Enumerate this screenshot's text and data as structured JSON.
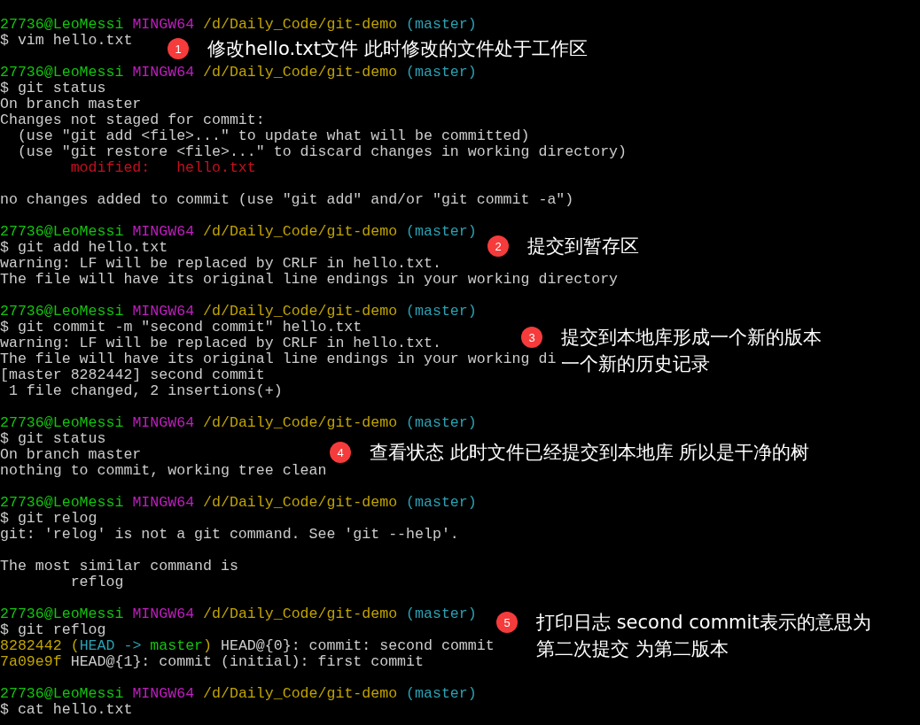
{
  "terminal_blocks": [
    {
      "lines": [
        {
          "segments": [
            {
              "text": "27736@LeoMessi",
              "color": "#13c40e"
            },
            {
              "text": " MINGW64",
              "color": "#c01ec0"
            },
            {
              "text": " /d/Daily_Code/git-demo",
              "color": "#c1a400"
            },
            {
              "text": " (master)",
              "color": "#2aa1b3"
            }
          ]
        },
        {
          "segments": [
            {
              "text": "$ vim hello.txt",
              "color": "#cccccc"
            }
          ]
        }
      ]
    },
    {
      "lines": [
        {
          "segments": [
            {
              "text": "27736@LeoMessi",
              "color": "#13c40e"
            },
            {
              "text": " MINGW64",
              "color": "#c01ec0"
            },
            {
              "text": " /d/Daily_Code/git-demo",
              "color": "#c1a400"
            },
            {
              "text": " (master)",
              "color": "#2aa1b3"
            }
          ]
        },
        {
          "segments": [
            {
              "text": "$ git status",
              "color": "#cccccc"
            }
          ]
        },
        {
          "segments": [
            {
              "text": "On branch master",
              "color": "#cccccc"
            }
          ]
        },
        {
          "segments": [
            {
              "text": "Changes not staged for commit:",
              "color": "#cccccc"
            }
          ]
        },
        {
          "segments": [
            {
              "text": "  (use \"git add <file>...\" to update what will be committed)",
              "color": "#cccccc"
            }
          ]
        },
        {
          "segments": [
            {
              "text": "  (use \"git restore <file>...\" to discard changes in working directory)",
              "color": "#cccccc"
            }
          ]
        },
        {
          "segments": [
            {
              "text": "        modified:   hello.txt",
              "color": "#c50f1f"
            }
          ]
        }
      ]
    },
    {
      "lines": [
        {
          "segments": [
            {
              "text": "no changes added to commit (use \"git add\" and/or \"git commit -a\")",
              "color": "#cccccc"
            }
          ]
        }
      ]
    },
    {
      "lines": [
        {
          "segments": [
            {
              "text": "27736@LeoMessi",
              "color": "#13c40e"
            },
            {
              "text": " MINGW64",
              "color": "#c01ec0"
            },
            {
              "text": " /d/Daily_Code/git-demo",
              "color": "#c1a400"
            },
            {
              "text": " (master)",
              "color": "#2aa1b3"
            }
          ]
        },
        {
          "segments": [
            {
              "text": "$ git add hello.txt",
              "color": "#cccccc"
            }
          ]
        },
        {
          "segments": [
            {
              "text": "warning: LF will be replaced by CRLF in hello.txt.",
              "color": "#cccccc"
            }
          ]
        },
        {
          "segments": [
            {
              "text": "The file will have its original line endings in your working directory",
              "color": "#cccccc"
            }
          ]
        }
      ]
    },
    {
      "lines": [
        {
          "segments": [
            {
              "text": "27736@LeoMessi",
              "color": "#13c40e"
            },
            {
              "text": " MINGW64",
              "color": "#c01ec0"
            },
            {
              "text": " /d/Daily_Code/git-demo",
              "color": "#c1a400"
            },
            {
              "text": " (master)",
              "color": "#2aa1b3"
            }
          ]
        },
        {
          "segments": [
            {
              "text": "$ git commit -m \"second commit\" hello.txt",
              "color": "#cccccc"
            }
          ]
        },
        {
          "segments": [
            {
              "text": "warning: LF will be replaced by CRLF in hello.txt.",
              "color": "#cccccc"
            }
          ]
        },
        {
          "segments": [
            {
              "text": "The file will have its original line endings in your working di",
              "color": "#cccccc"
            }
          ]
        },
        {
          "segments": [
            {
              "text": "[master 8282442] second commit",
              "color": "#cccccc"
            }
          ]
        },
        {
          "segments": [
            {
              "text": " 1 file changed, 2 insertions(+)",
              "color": "#cccccc"
            }
          ]
        }
      ]
    },
    {
      "lines": [
        {
          "segments": [
            {
              "text": "27736@LeoMessi",
              "color": "#13c40e"
            },
            {
              "text": " MINGW64",
              "color": "#c01ec0"
            },
            {
              "text": " /d/Daily_Code/git-demo",
              "color": "#c1a400"
            },
            {
              "text": " (master)",
              "color": "#2aa1b3"
            }
          ]
        },
        {
          "segments": [
            {
              "text": "$ git status",
              "color": "#cccccc"
            }
          ]
        },
        {
          "segments": [
            {
              "text": "On branch master",
              "color": "#cccccc"
            }
          ]
        },
        {
          "segments": [
            {
              "text": "nothing to commit, working tree clean",
              "color": "#cccccc"
            }
          ]
        }
      ]
    },
    {
      "lines": [
        {
          "segments": [
            {
              "text": "27736@LeoMessi",
              "color": "#13c40e"
            },
            {
              "text": " MINGW64",
              "color": "#c01ec0"
            },
            {
              "text": " /d/Daily_Code/git-demo",
              "color": "#c1a400"
            },
            {
              "text": " (master)",
              "color": "#2aa1b3"
            }
          ]
        },
        {
          "segments": [
            {
              "text": "$ git relog",
              "color": "#cccccc"
            }
          ]
        },
        {
          "segments": [
            {
              "text": "git: 'relog' is not a git command. See 'git --help'.",
              "color": "#cccccc"
            }
          ]
        }
      ]
    },
    {
      "lines": [
        {
          "segments": [
            {
              "text": "The most similar command is",
              "color": "#cccccc"
            }
          ]
        },
        {
          "segments": [
            {
              "text": "        reflog",
              "color": "#cccccc"
            }
          ]
        }
      ]
    },
    {
      "lines": [
        {
          "segments": [
            {
              "text": "27736@LeoMessi",
              "color": "#13c40e"
            },
            {
              "text": " MINGW64",
              "color": "#c01ec0"
            },
            {
              "text": " /d/Daily_Code/git-demo",
              "color": "#c1a400"
            },
            {
              "text": " (master)",
              "color": "#2aa1b3"
            }
          ]
        },
        {
          "segments": [
            {
              "text": "$ git reflog",
              "color": "#cccccc"
            }
          ]
        },
        {
          "segments": [
            {
              "text": "8282442",
              "color": "#c1a400"
            },
            {
              "text": " (",
              "color": "#c1a400"
            },
            {
              "text": "HEAD -> ",
              "color": "#2aa1b3"
            },
            {
              "text": "master",
              "color": "#13c40e"
            },
            {
              "text": ")",
              "color": "#c1a400"
            },
            {
              "text": " HEAD@{0}: commit: second commit",
              "color": "#cccccc"
            }
          ]
        },
        {
          "segments": [
            {
              "text": "7a09e9f",
              "color": "#c1a400"
            },
            {
              "text": " HEAD@{1}: commit (initial): first commit",
              "color": "#cccccc"
            }
          ]
        }
      ]
    },
    {
      "lines": [
        {
          "segments": [
            {
              "text": "27736@LeoMessi",
              "color": "#13c40e"
            },
            {
              "text": " MINGW64",
              "color": "#c01ec0"
            },
            {
              "text": " /d/Daily_Code/git-demo",
              "color": "#c1a400"
            },
            {
              "text": " (master)",
              "color": "#2aa1b3"
            }
          ]
        },
        {
          "segments": [
            {
              "text": "$ cat hello.txt",
              "color": "#cccccc"
            }
          ]
        }
      ]
    }
  ],
  "annotations": [
    {
      "number": "1",
      "lines": [
        "修改hello.txt文件 此时修改的文件处于工作区"
      ]
    },
    {
      "number": "2",
      "lines": [
        "提交到暂存区"
      ]
    },
    {
      "number": "3",
      "lines": [
        "提交到本地库形成一个新的版本",
        "一个新的历史记录"
      ]
    },
    {
      "number": "4",
      "lines": [
        "查看状态 此时文件已经提交到本地库 所以是干净的树"
      ]
    },
    {
      "number": "5",
      "lines": [
        "打印日志 second commit表示的意思为",
        "第二次提交 为第二版本"
      ]
    }
  ]
}
